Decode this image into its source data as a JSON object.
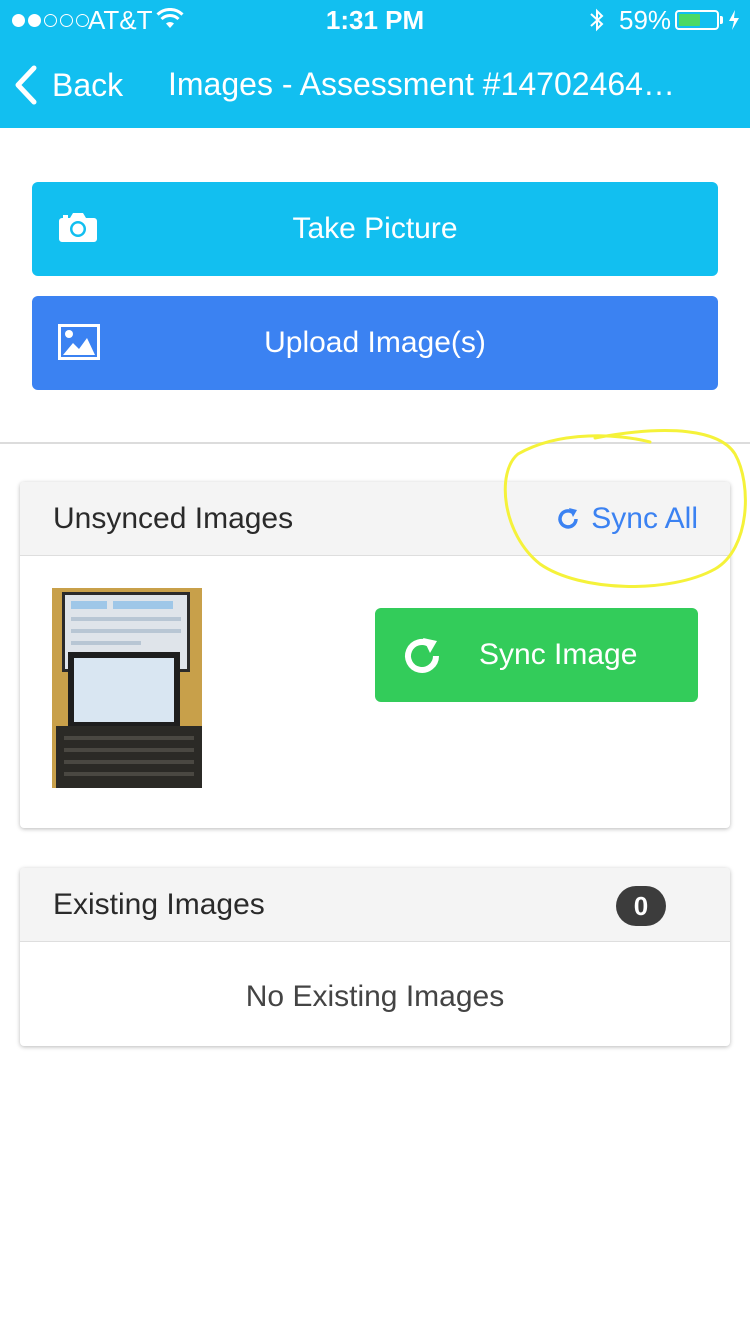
{
  "status_bar": {
    "carrier": "AT&T",
    "time": "1:31 PM",
    "battery": "59%",
    "battery_level": 0.59,
    "signal_bars": 2
  },
  "nav": {
    "back_label": "Back",
    "title": "Images - Assessment #14702464…"
  },
  "actions": {
    "take_picture": "Take Picture",
    "upload_images": "Upload Image(s)"
  },
  "unsynced": {
    "title": "Unsynced Images",
    "sync_all": "Sync All",
    "sync_image": "Sync Image"
  },
  "existing": {
    "title": "Existing Images",
    "count": "0",
    "empty_text": "No Existing Images"
  },
  "colors": {
    "header": "#12bff0",
    "take_picture": "#12bff0",
    "upload": "#3b82f2",
    "sync_image": "#33cc5a",
    "link": "#3b82f2",
    "annotation": "#f5f23a"
  }
}
